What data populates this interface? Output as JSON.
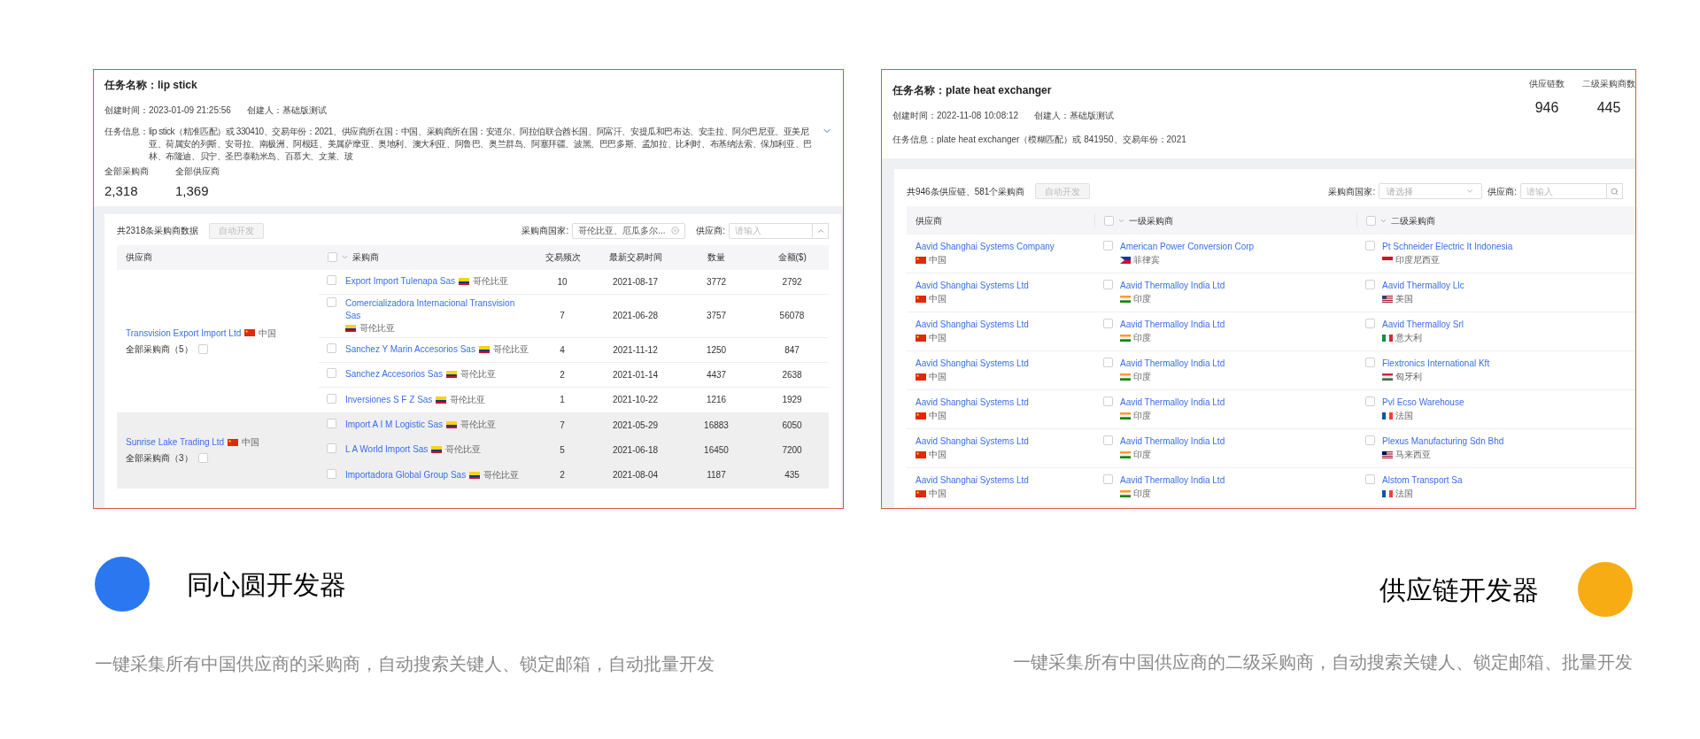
{
  "buyer_task": {
    "title_label": "任务名称：",
    "title": "lip stick",
    "meta": [
      {
        "label": "创建时间：",
        "value": "2023-01-09 21:25:56"
      },
      {
        "label": "创建人：",
        "value": "基础版测试"
      }
    ],
    "info_label": "任务信息：",
    "info": "lip stick（精准匹配）或 330410、交易年份：2021、供应商所在国：中国、采购商所在国：安道尔、阿拉伯联合酋长国、阿富汗、安提瓜和巴布达、安圭拉、阿尔巴尼亚、亚美尼亚、荷属安的列斯、安哥拉、南极洲、阿根廷、美属萨摩亚、奥地利、澳大利亚、阿鲁巴、奥兰群岛、阿塞拜疆、波黑、巴巴多斯、孟加拉、比利时、布基纳法索、保加利亚、巴林、布隆迪、贝宁、圣巴泰勒米岛、百慕大、文莱、玻",
    "stats": [
      {
        "label": "全部采购商",
        "value": "2,318"
      },
      {
        "label": "全部供应商",
        "value": "1,369"
      }
    ],
    "count_text": "共2318条采购商数据",
    "auto_button": {
      "label": "自动开发",
      "disabled": true
    },
    "country_filter": {
      "label": "采购商国家:",
      "value": "哥伦比亚、厄瓜多尔..."
    },
    "supplier_filter": {
      "label": "供应商:",
      "placeholder": "请输入"
    },
    "columns": [
      "供应商",
      "采购商",
      "交易频次",
      "最新交易时间",
      "数量",
      "金额($)"
    ],
    "header_checked": false,
    "groups": [
      {
        "supplier": "Transvision Export Import Ltd",
        "flag": {
          "kind": "cn"
        },
        "country": "中国",
        "all_label": "全部采购商（5）",
        "checked": false,
        "highlighted": false,
        "rows": [
          {
            "buyer": "Export Import Tulenapa Sas",
            "flag": {
              "kind": "co"
            },
            "country": "哥伦比亚",
            "checked": false,
            "frequency": "10",
            "date": "2021-08-17",
            "quantity": "3772",
            "amount": "2792"
          },
          {
            "buyer": "Comercializadora Internacional Transvision Sas",
            "flag": {
              "kind": "co"
            },
            "country": "哥伦比亚",
            "checked": false,
            "frequency": "7",
            "date": "2021-06-28",
            "quantity": "3757",
            "amount": "56078"
          },
          {
            "buyer": "Sanchez Y Marin Accesorios Sas",
            "flag": {
              "kind": "co"
            },
            "country": "哥伦比亚",
            "checked": false,
            "frequency": "4",
            "date": "2021-11-12",
            "quantity": "1250",
            "amount": "847"
          },
          {
            "buyer": "Sanchez Accesorios Sas",
            "flag": {
              "kind": "co"
            },
            "country": "哥伦比亚",
            "checked": false,
            "frequency": "2",
            "date": "2021-01-14",
            "quantity": "4437",
            "amount": "2638"
          },
          {
            "buyer": "Inversiones S F Z Sas",
            "flag": {
              "kind": "co"
            },
            "country": "哥伦比亚",
            "checked": false,
            "frequency": "1",
            "date": "2021-10-22",
            "quantity": "1216",
            "amount": "1929"
          }
        ]
      },
      {
        "supplier": "Sunrise Lake Trading Ltd",
        "flag": {
          "kind": "cn"
        },
        "country": "中国",
        "all_label": "全部采购商（3）",
        "checked": false,
        "highlighted": true,
        "rows": [
          {
            "buyer": "Import A I M Logistic Sas",
            "flag": {
              "kind": "co"
            },
            "country": "哥伦比亚",
            "checked": false,
            "frequency": "7",
            "date": "2021-05-29",
            "quantity": "16883",
            "amount": "6050"
          },
          {
            "buyer": "L A World Import Sas",
            "flag": {
              "kind": "co"
            },
            "country": "哥伦比亚",
            "checked": false,
            "frequency": "5",
            "date": "2021-06-18",
            "quantity": "16450",
            "amount": "7200"
          },
          {
            "buyer": "Importadora Global Group Sas",
            "flag": {
              "kind": "co"
            },
            "country": "哥伦比亚",
            "checked": false,
            "frequency": "2",
            "date": "2021-08-04",
            "quantity": "1187",
            "amount": "435"
          }
        ]
      }
    ]
  },
  "chain_task": {
    "title_label": "任务名称：",
    "title": "plate heat exchanger",
    "meta": [
      {
        "label": "创建时间：",
        "value": "2022-11-08 10:08:12"
      },
      {
        "label": "创建人：",
        "value": "基础版测试"
      }
    ],
    "info_label": "任务信息：",
    "info": "plate heat exchanger（模糊匹配）或 841950、交易年份：2021",
    "stats": [
      {
        "label": "供应链数",
        "value": "946"
      },
      {
        "label": "二级采购商数",
        "value": "445"
      }
    ],
    "count_text": "共946条供应链、581个采购商",
    "auto_button": {
      "label": "自动开发",
      "disabled": true
    },
    "country_filter": {
      "label": "采购商国家:",
      "placeholder": "请选择"
    },
    "supplier_filter": {
      "label": "供应商:",
      "placeholder": "请输入"
    },
    "columns": [
      {
        "label": "供应商"
      },
      {
        "label": "一级采购商",
        "checked": false
      },
      {
        "label": "二级采购商",
        "checked": false
      }
    ],
    "rows": [
      {
        "supplier": {
          "name": "Aavid Shanghai Systems Company",
          "flag": {
            "kind": "cn"
          },
          "country": "中国"
        },
        "tier1": {
          "name": "American Power Conversion Corp",
          "flag": {
            "kind": "ph"
          },
          "country": "菲律宾",
          "checked": false
        },
        "tier2": {
          "name": "Pt Schneider Electric It Indonesia",
          "flag": {
            "kind": "id"
          },
          "country": "印度尼西亚",
          "checked": false
        }
      },
      {
        "supplier": {
          "name": "Aavid Shanghai Systems Ltd",
          "flag": {
            "kind": "cn"
          },
          "country": "中国"
        },
        "tier1": {
          "name": "Aavid Thermalloy India Ltd",
          "flag": {
            "kind": "in"
          },
          "country": "印度",
          "checked": false
        },
        "tier2": {
          "name": "Aavid Thermalloy Llc",
          "flag": {
            "kind": "us"
          },
          "country": "美国",
          "checked": false
        }
      },
      {
        "supplier": {
          "name": "Aavid Shanghai Systems Ltd",
          "flag": {
            "kind": "cn"
          },
          "country": "中国"
        },
        "tier1": {
          "name": "Aavid Thermalloy India Ltd",
          "flag": {
            "kind": "in"
          },
          "country": "印度",
          "checked": false
        },
        "tier2": {
          "name": "Aavid Thermalloy Srl",
          "flag": {
            "kind": "it"
          },
          "country": "意大利",
          "checked": false
        }
      },
      {
        "supplier": {
          "name": "Aavid Shanghai Systems Ltd",
          "flag": {
            "kind": "cn"
          },
          "country": "中国"
        },
        "tier1": {
          "name": "Aavid Thermalloy India Ltd",
          "flag": {
            "kind": "in"
          },
          "country": "印度",
          "checked": false
        },
        "tier2": {
          "name": "Flextronics International Kft",
          "flag": {
            "kind": "hu"
          },
          "country": "匈牙利",
          "checked": false
        }
      },
      {
        "supplier": {
          "name": "Aavid Shanghai Systems Ltd",
          "flag": {
            "kind": "cn"
          },
          "country": "中国"
        },
        "tier1": {
          "name": "Aavid Thermalloy India Ltd",
          "flag": {
            "kind": "in"
          },
          "country": "印度",
          "checked": false
        },
        "tier2": {
          "name": "Pvl Ecso Warehouse",
          "flag": {
            "kind": "fr"
          },
          "country": "法国",
          "checked": false
        }
      },
      {
        "supplier": {
          "name": "Aavid Shanghai Systems Ltd",
          "flag": {
            "kind": "cn"
          },
          "country": "中国"
        },
        "tier1": {
          "name": "Aavid Thermalloy India Ltd",
          "flag": {
            "kind": "in"
          },
          "country": "印度",
          "checked": false
        },
        "tier2": {
          "name": "Plexus Manufacturing Sdn Bhd",
          "flag": {
            "kind": "my"
          },
          "country": "马来西亚",
          "checked": false
        }
      },
      {
        "supplier": {
          "name": "Aavid Shanghai Systems Ltd",
          "flag": {
            "kind": "cn"
          },
          "country": "中国"
        },
        "tier1": {
          "name": "Aavid Thermalloy India Ltd",
          "flag": {
            "kind": "in"
          },
          "country": "印度",
          "checked": false
        },
        "tier2": {
          "name": "Alstom Transport Sa",
          "flag": {
            "kind": "fr"
          },
          "country": "法国",
          "checked": false
        }
      }
    ]
  },
  "features": [
    {
      "kind": "circle-left",
      "title": "同心圆开发器",
      "description": "一键采集所有中国供应商的采购商，自动搜索关键人、锁定邮箱，自动批量开发",
      "color": "#2a77f0"
    },
    {
      "kind": "circle-right",
      "title": "供应链开发器",
      "description": "一键采集所有中国供应商的二级采购商，自动搜索关键人、锁定邮箱、批量开发",
      "color": "#f8ac14"
    }
  ]
}
